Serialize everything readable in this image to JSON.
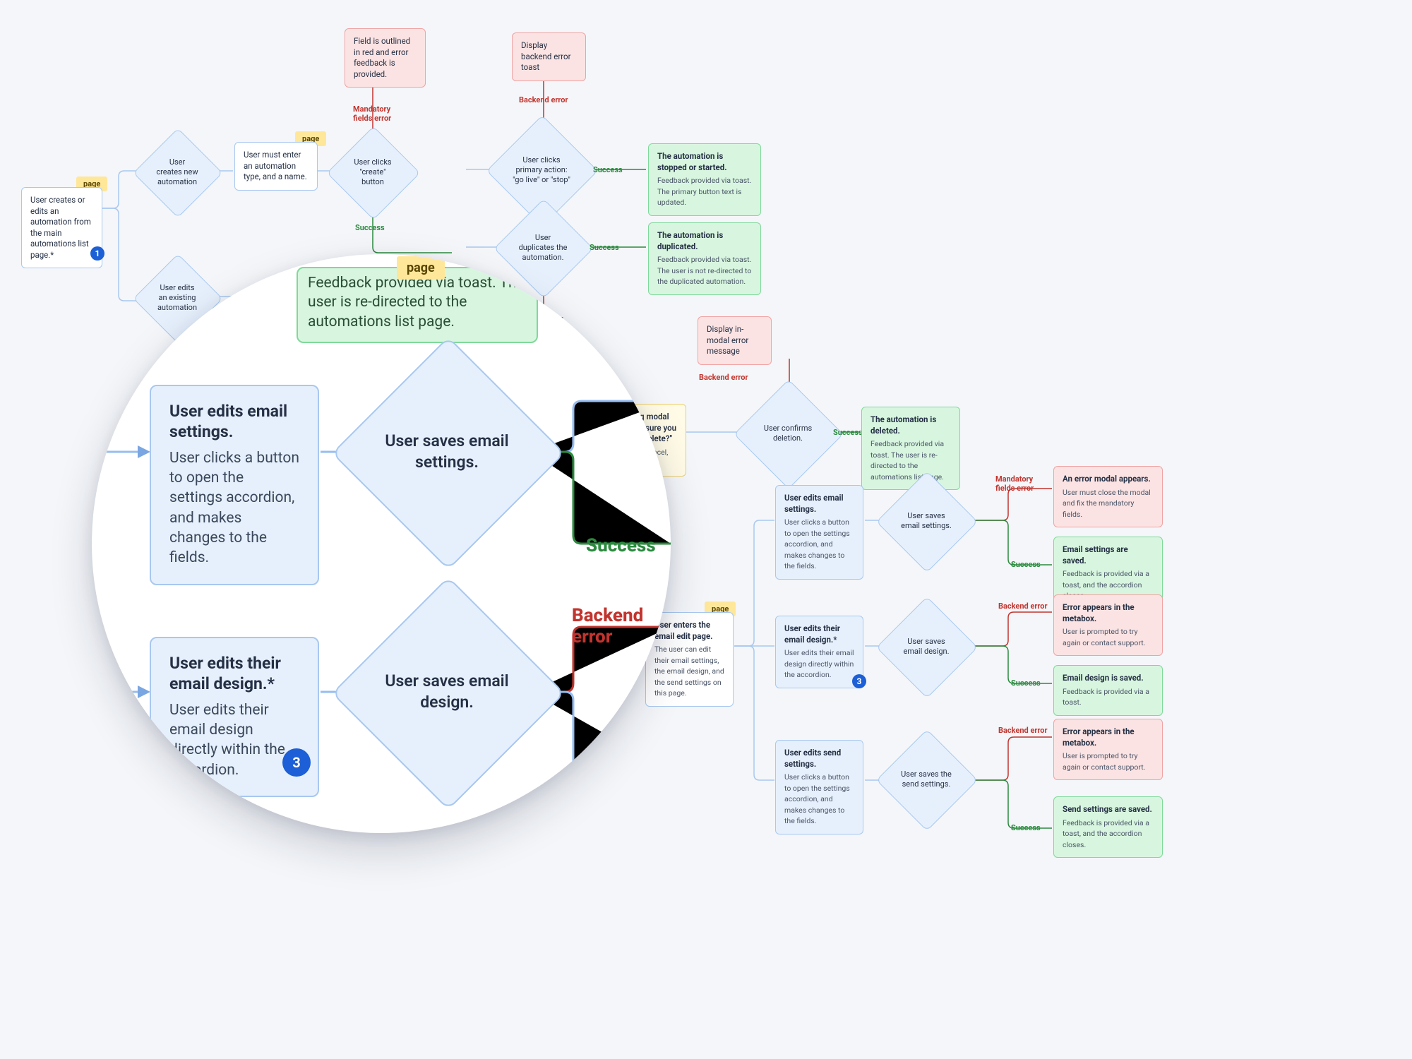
{
  "tags": {
    "page": "page"
  },
  "edgeLabels": {
    "success": "Success",
    "backendError": "Backend error",
    "mandatoryFieldsError": "Mandatory\nfields error"
  },
  "boxes": {
    "start": {
      "text": "User creates or edits an automation from the main automations list page.*"
    },
    "fieldRed": {
      "text": "Field is outlined in red and error feedback is provided."
    },
    "backendToast": {
      "text": "Display backend error toast"
    },
    "mustEnter": {
      "text": "User must enter an automation type, and a name."
    },
    "feedbackToast": {
      "text": "Feedback provided via toast. The user is re-directed to the automations list page."
    },
    "warningModal": {
      "title": "Warning modal \"are you sure you want to delete?\"",
      "sub": "User can cancel, or:"
    },
    "inModalError": {
      "text": "Display in-modal error message"
    },
    "startStop": {
      "title": "The automation is stopped or started.",
      "sub": "Feedback provided via toast. The primary button text is updated."
    },
    "duplicated": {
      "title": "The automation is duplicated.",
      "sub": "Feedback provided via toast. The user is not re-directed to the duplicated automation."
    },
    "deleted": {
      "title": "The automation is deleted.",
      "sub": "Feedback provided via toast. The user is re-directed to the automations list page."
    },
    "editEmail": {
      "title": "User edits email settings.",
      "sub": "User clicks a button to open the settings accordion, and makes changes to the fields."
    },
    "editDesign": {
      "title": "User edits their email design.*",
      "sub": "User edits their email design directly within the accordion."
    },
    "editSend": {
      "title": "User edits send settings.",
      "sub": "User clicks a button to open the settings accordion, and makes changes to the fields."
    },
    "entersPage": {
      "title": "User enters the email edit page.",
      "sub": "The user can edit their email settings, the email design, and the send settings on this page."
    },
    "errModal": {
      "title": "An error modal appears.",
      "sub": "User must close the modal and fix the mandatory fields."
    },
    "emailSaved": {
      "title": "Email settings are saved.",
      "sub": "Feedback is provided via a toast, and the accordion closes."
    },
    "errMetabox": {
      "title": "Error appears in the metabox.",
      "sub": "User is prompted to try again or contact support."
    },
    "designSaved": {
      "title": "Email design is saved.",
      "sub": "Feedback is provided via a toast."
    },
    "errMetabox2": {
      "title": "Error appears in the metabox.",
      "sub": "User is prompted to try again or contact support."
    },
    "sendSaved": {
      "title": "Send settings are saved.",
      "sub": "Feedback is provided via a toast, and the accordion closes."
    }
  },
  "diamonds": {
    "createNew": "User creates new automation",
    "editExisting": "User edits an existing automation",
    "clickCreate": "User clicks \"create\" button",
    "primaryAction": "User clicks primary action: \"go live\" or \"stop\"",
    "duplicates": "User duplicates the automation.",
    "confirmsDel": "User confirms deletion.",
    "savesEmail": "User saves email settings.",
    "savesDesign": "User saves email design.",
    "savesSend": "User saves the send settings."
  },
  "badges": {
    "one": "1",
    "three": "3"
  },
  "lens": {
    "editEmail": {
      "title": "User edits email settings.",
      "sub": "User clicks a button to open the settings accordion, and makes changes to the fields."
    },
    "savesEmail": "User saves email settings.",
    "editDesign": {
      "title": "User edits their email design.*",
      "sub": "User edits their email design directly within the accordion."
    },
    "savesDesign": "User saves email design.",
    "success": "Success",
    "backendErr": "Backend error",
    "feedbackFragment": "Feedback provided via toast. The user is re-directed to the automations list page.",
    "ess": "ess",
    "three": "3"
  }
}
